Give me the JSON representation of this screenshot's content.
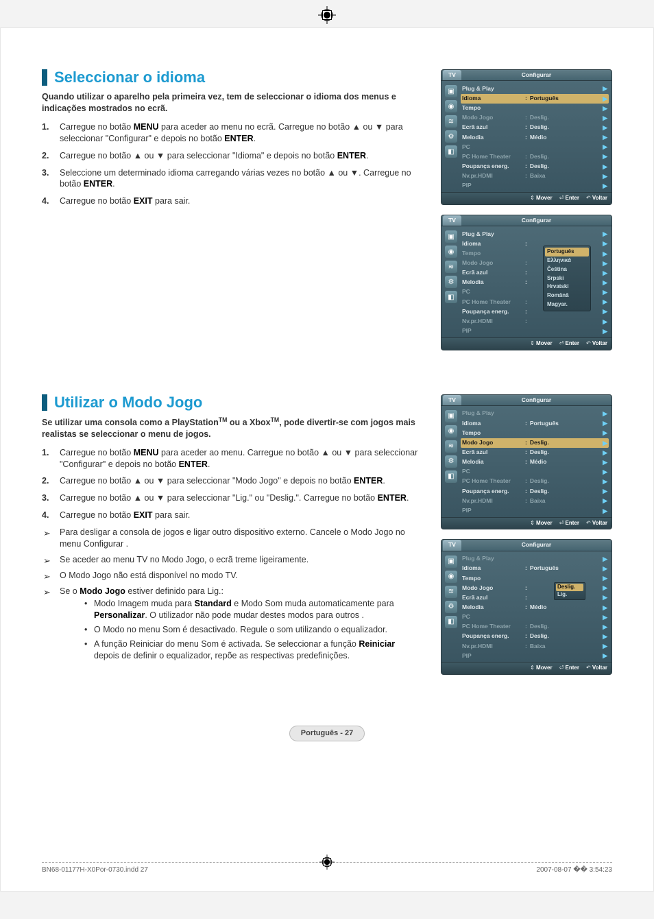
{
  "s1": {
    "title": "Seleccionar o idioma",
    "intro": "Quando utilizar o aparelho pela primeira vez, tem de seleccionar o idioma dos menus e indicações mostrados no ecrã.",
    "steps": [
      {
        "pre": "Carregue no botão ",
        "b1": "MENU",
        "mid": " para aceder ao menu no ecrã. Carregue no botão ▲ ou ▼ para seleccionar \"Configurar\" e depois no botão ",
        "b2": "ENTER",
        "post": "."
      },
      {
        "pre": "Carregue no botão ▲ ou ▼ para seleccionar \"Idioma\" e depois no botão ",
        "b1": "ENTER",
        "post": "."
      },
      {
        "pre": "Seleccione um determinado idioma carregando várias vezes no botão ▲ ou ▼. Carregue no botão ",
        "b1": "ENTER",
        "post": "."
      },
      {
        "pre": "Carregue no botão ",
        "b1": "EXIT",
        "post": " para sair."
      }
    ],
    "panel1": {
      "tv": "TV",
      "title": "Configurar",
      "rows": [
        {
          "lbl": "Plug & Play",
          "dim": false
        },
        {
          "lbl": "Idioma",
          "val": "Português",
          "sel": true
        },
        {
          "lbl": "Tempo",
          "dim": false
        },
        {
          "lbl": "Modo Jogo",
          "val": "Deslig.",
          "dim": true
        },
        {
          "lbl": "Ecrã azul",
          "val": "Deslig."
        },
        {
          "lbl": "Melodia",
          "val": "Médio"
        },
        {
          "lbl": "PC",
          "dim": true
        },
        {
          "lbl": "PC Home Theater",
          "val": "Deslig.",
          "dim": true
        },
        {
          "lbl": "Poupança energ.",
          "val": "Deslig."
        },
        {
          "lbl": "Nv.pr.HDMI",
          "val": "Baixa",
          "dim": true
        },
        {
          "lbl": "PIP",
          "dim": true
        }
      ],
      "footer": {
        "mover": "Mover",
        "enter": "Enter",
        "voltar": "Voltar"
      }
    },
    "panel2": {
      "tv": "TV",
      "title": "Configurar",
      "rows": [
        {
          "lbl": "Plug & Play"
        },
        {
          "lbl": "Idioma",
          "colon": true
        },
        {
          "lbl": "Tempo",
          "dim": true
        },
        {
          "lbl": "Modo Jogo",
          "colon": true,
          "dim": true
        },
        {
          "lbl": "Ecrã azul",
          "colon": true
        },
        {
          "lbl": "Melodia",
          "colon": true
        },
        {
          "lbl": "PC",
          "dim": true
        },
        {
          "lbl": "PC Home Theater",
          "colon": true,
          "dim": true
        },
        {
          "lbl": "Poupança energ.",
          "colon": true
        },
        {
          "lbl": "Nv.pr.HDMI",
          "colon": true,
          "dim": true
        },
        {
          "lbl": "PIP",
          "dim": true
        }
      ],
      "dropdown": [
        "Português",
        "Ελληνικά",
        "Čeština",
        "Srpski",
        "Hrvatski",
        "Română",
        "Magyar."
      ],
      "footer": {
        "mover": "Mover",
        "enter": "Enter",
        "voltar": "Voltar"
      }
    }
  },
  "s2": {
    "title": "Utilizar o Modo Jogo",
    "intro_a": "Se utilizar uma consola como a PlayStation",
    "intro_b": " ou a Xbox",
    "intro_c": ", pode divertir-se com jogos mais realistas se seleccionar o menu de jogos.",
    "steps": [
      {
        "pre": "Carregue no botão ",
        "b1": "MENU",
        "mid": " para aceder ao menu. Carregue no botão ▲ ou ▼ para seleccionar \"Configurar\" e depois no botão ",
        "b2": "ENTER",
        "post": "."
      },
      {
        "pre": "Carregue no botão ▲ ou ▼ para seleccionar \"Modo Jogo\" e depois no botão ",
        "b1": "ENTER",
        "post": "."
      },
      {
        "pre": "Carregue no botão ▲ ou ▼ para seleccionar \"Lig.\" ou \"Deslig.\". Carregue no botão ",
        "b1": "ENTER",
        "post": "."
      },
      {
        "pre": "Carregue no botão ",
        "b1": "EXIT",
        "post": " para sair."
      }
    ],
    "notes": [
      "Para desligar a consola de jogos e ligar outro dispositivo externo. Cancele o Modo Jogo no menu Configurar .",
      "Se aceder ao menu TV no Modo Jogo, o ecrã treme ligeiramente.",
      "O Modo Jogo não está disponível no modo TV."
    ],
    "note_final_a": "Se o ",
    "note_final_b": "Modo Jogo",
    "note_final_c": " estiver definido para Lig.:",
    "bullets_a": {
      "pre": "Modo Imagem muda para ",
      "b1": "Standard",
      "mid": " e Modo Som muda automaticamente para ",
      "b2": "Personalizar",
      "post": ". O utilizador não pode mudar destes modos para outros ."
    },
    "bullets_b": "O Modo no menu Som é desactivado. Regule o som utilizando o equalizador.",
    "bullets_c": {
      "pre": "A função Reiniciar do menu Som é activada. Se seleccionar a função ",
      "b1": "Reiniciar",
      "post": " depois de definir o equalizador, repõe as respectivas predefinições."
    },
    "panel3": {
      "tv": "TV",
      "title": "Configurar",
      "rows": [
        {
          "lbl": "Plug & Play",
          "dim": true
        },
        {
          "lbl": "Idioma",
          "val": "Português"
        },
        {
          "lbl": "Tempo"
        },
        {
          "lbl": "Modo Jogo",
          "val": "Deslig.",
          "sel": true
        },
        {
          "lbl": "Ecrã azul",
          "val": "Deslig."
        },
        {
          "lbl": "Melodia",
          "val": "Médio"
        },
        {
          "lbl": "PC",
          "dim": true
        },
        {
          "lbl": "PC Home Theater",
          "val": "Deslig.",
          "dim": true
        },
        {
          "lbl": "Poupança energ.",
          "val": "Deslig."
        },
        {
          "lbl": "Nv.pr.HDMI",
          "val": "Baixa",
          "dim": true
        },
        {
          "lbl": "PIP",
          "dim": true
        }
      ],
      "footer": {
        "mover": "Mover",
        "enter": "Enter",
        "voltar": "Voltar"
      }
    },
    "panel4": {
      "tv": "TV",
      "title": "Configurar",
      "rows": [
        {
          "lbl": "Plug & Play",
          "dim": true
        },
        {
          "lbl": "Idioma",
          "val": "Português"
        },
        {
          "lbl": "Tempo"
        },
        {
          "lbl": "Modo Jogo",
          "colon": true,
          "optbox": true
        },
        {
          "lbl": "Ecrã azul",
          "colon": true
        },
        {
          "lbl": "Melodia",
          "val": "Médio"
        },
        {
          "lbl": "PC",
          "dim": true
        },
        {
          "lbl": "PC Home Theater",
          "val": "Deslig.",
          "dim": true
        },
        {
          "lbl": "Poupança energ.",
          "val": "Deslig."
        },
        {
          "lbl": "Nv.pr.HDMI",
          "val": "Baixa",
          "dim": true
        },
        {
          "lbl": "PIP",
          "dim": true
        }
      ],
      "optbox": {
        "o1": "Deslig.",
        "o2": "Lig."
      },
      "footer": {
        "mover": "Mover",
        "enter": "Enter",
        "voltar": "Voltar"
      }
    }
  },
  "page_label": "Português - 27",
  "footer_left": "BN68-01177H-X0Por-0730.indd   27",
  "footer_right": "2007-08-07   �� 3:54:23"
}
